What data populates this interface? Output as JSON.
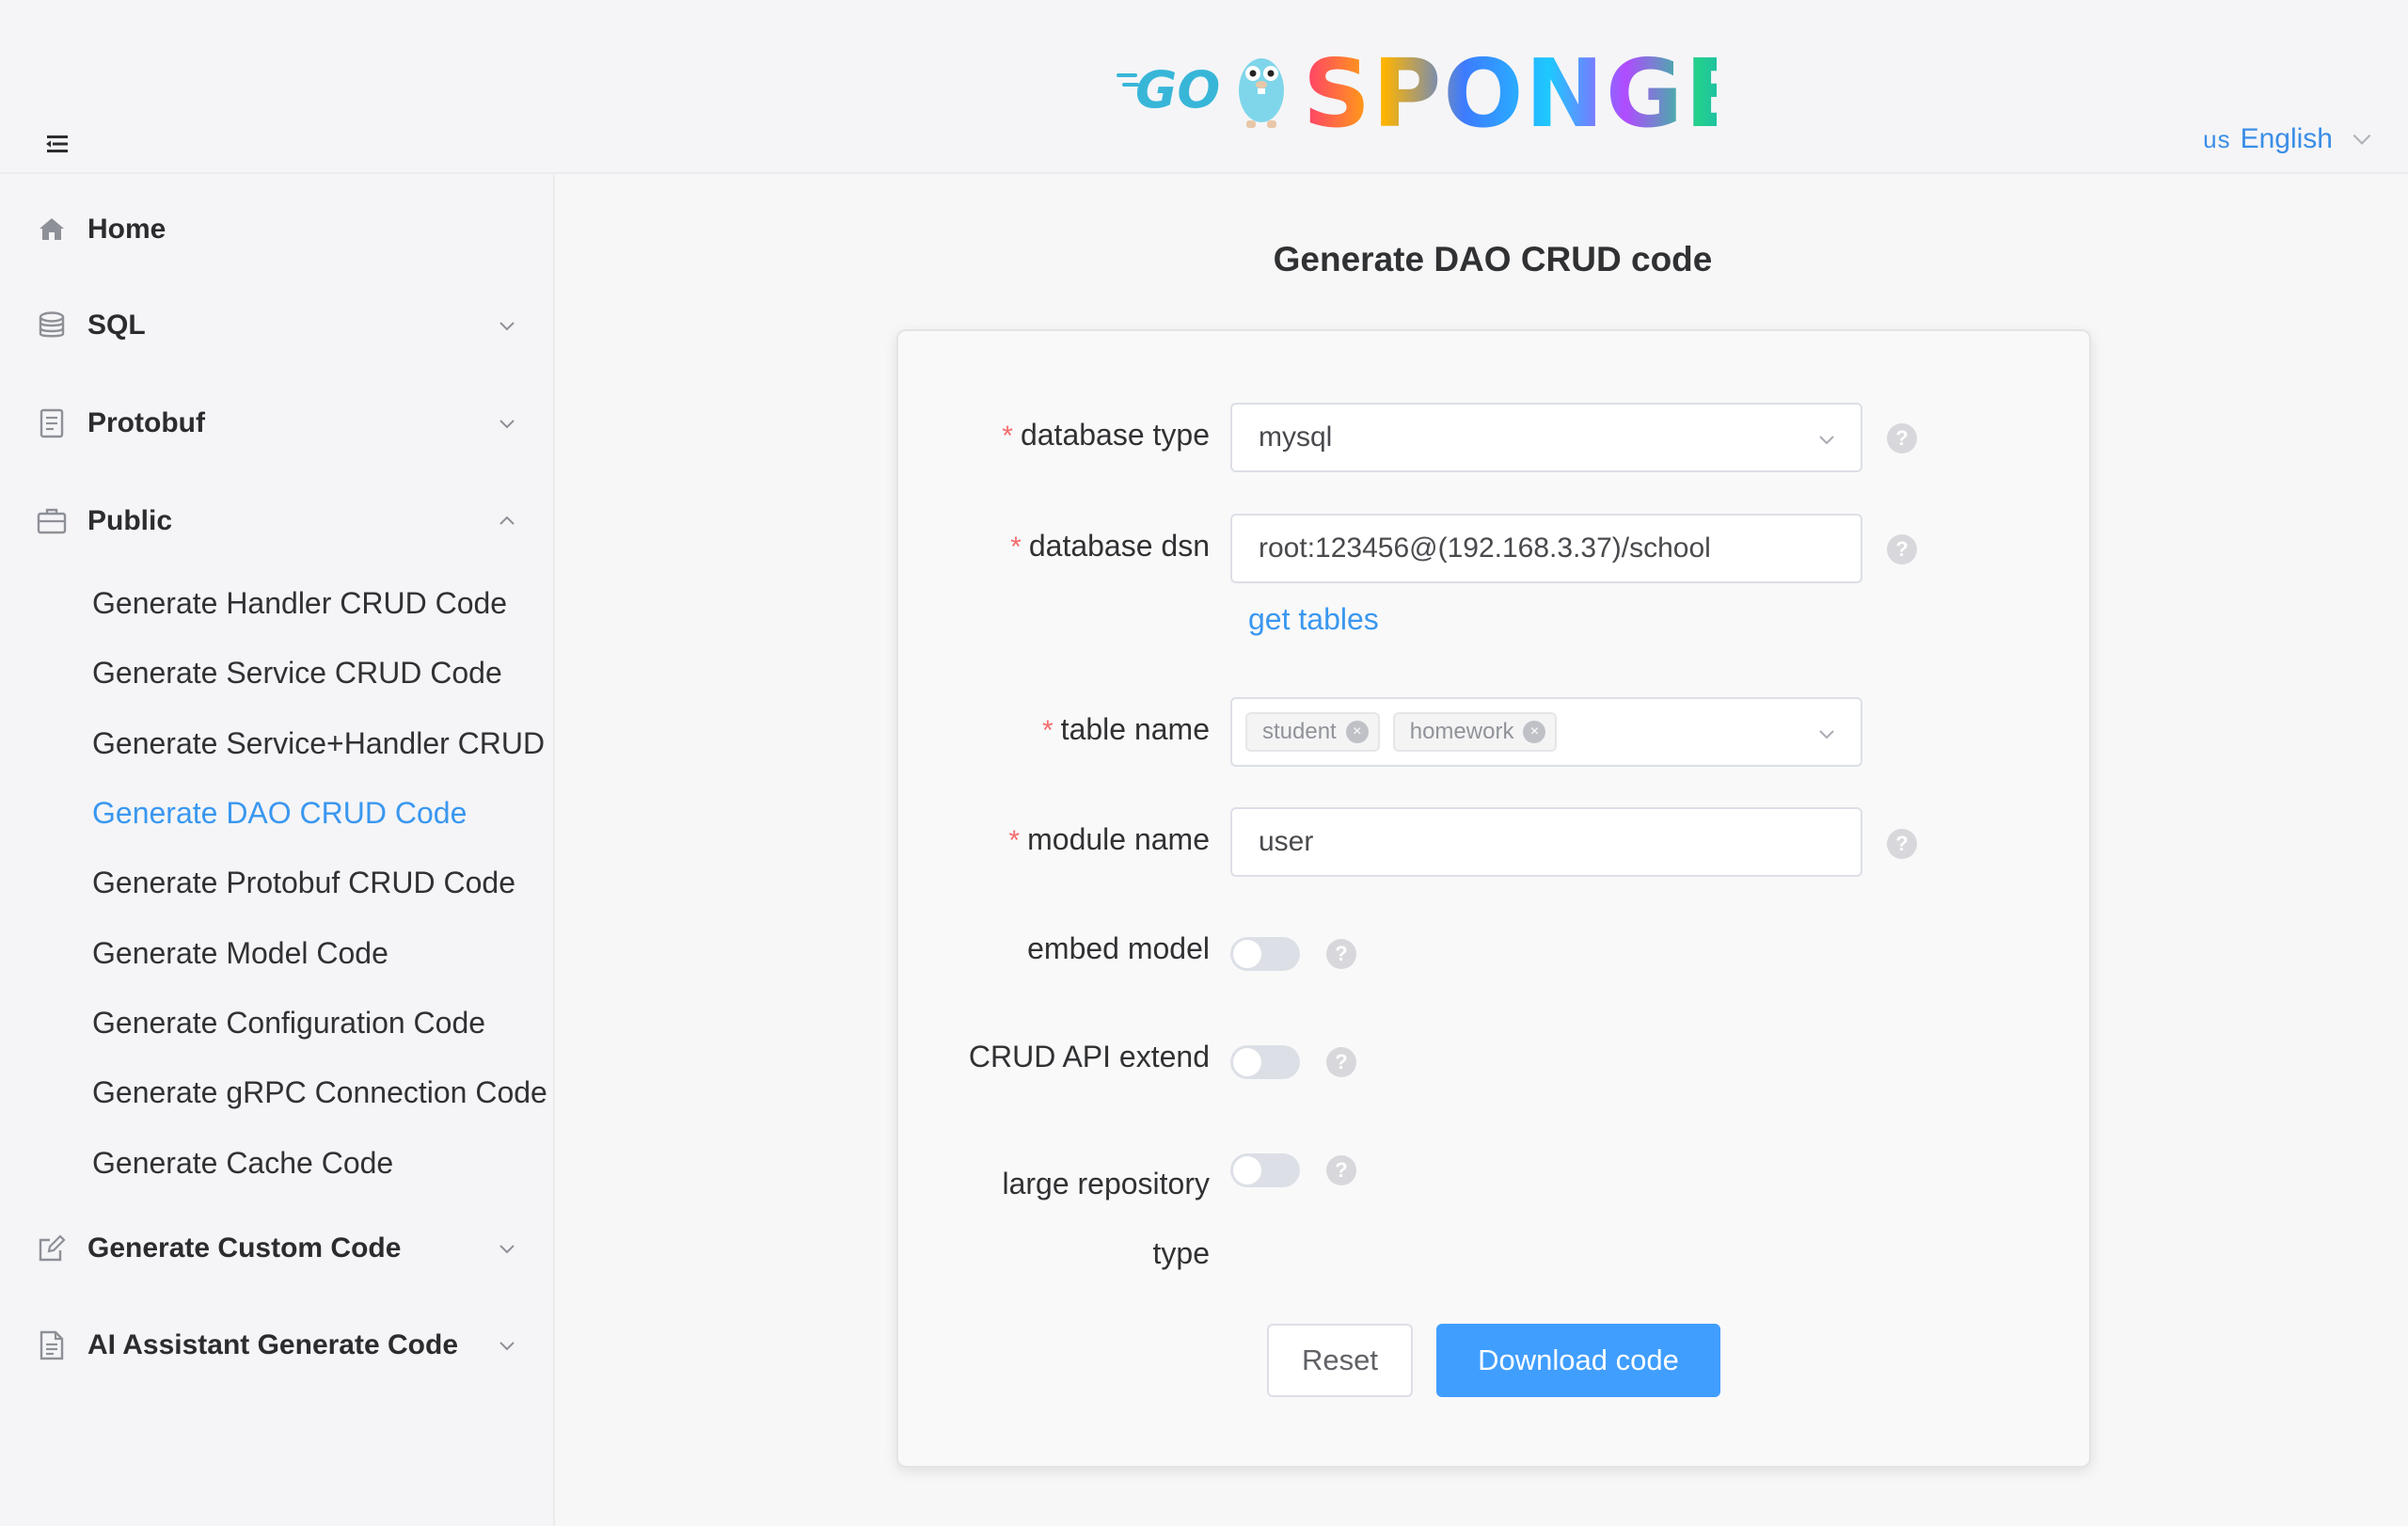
{
  "header": {
    "logo_text": "GO SPONGE",
    "language": {
      "flag": "us",
      "label": "English"
    }
  },
  "sidebar": {
    "groups": [
      {
        "label": "Home",
        "icon": "home-icon"
      },
      {
        "label": "SQL",
        "icon": "database-icon",
        "expanded": false
      },
      {
        "label": "Protobuf",
        "icon": "document-icon",
        "expanded": false
      },
      {
        "label": "Public",
        "icon": "briefcase-icon",
        "expanded": true
      },
      {
        "label": "Generate Custom Code",
        "icon": "edit-icon",
        "expanded": false
      },
      {
        "label": "AI Assistant Generate Code",
        "icon": "file-text-icon",
        "expanded": false
      }
    ],
    "public_items": [
      {
        "label": "Generate Handler CRUD Code"
      },
      {
        "label": "Generate Service CRUD Code"
      },
      {
        "label": "Generate Service+Handler CRUD C"
      },
      {
        "label": "Generate DAO CRUD Code",
        "active": true
      },
      {
        "label": "Generate Protobuf CRUD Code"
      },
      {
        "label": "Generate Model Code"
      },
      {
        "label": "Generate Configuration Code"
      },
      {
        "label": "Generate gRPC Connection Code"
      },
      {
        "label": "Generate Cache Code"
      }
    ]
  },
  "main": {
    "title": "Generate DAO CRUD code",
    "form": {
      "database_type": {
        "label": "database type",
        "value": "mysql",
        "required": true
      },
      "database_dsn": {
        "label": "database dsn",
        "value": "root:123456@(192.168.3.37)/school",
        "required": true
      },
      "get_tables_link": "get tables",
      "table_name": {
        "label": "table name",
        "tags": [
          "student",
          "homework"
        ],
        "required": true
      },
      "module_name": {
        "label": "module name",
        "value": "user",
        "required": true
      },
      "embed_model": {
        "label": "embed model",
        "on": false
      },
      "crud_api_extend": {
        "label": "CRUD API extend",
        "on": false
      },
      "large_repository": {
        "label_line1": "large repository",
        "label_line2": "type",
        "on": false
      },
      "required_mark": "*",
      "help_glyph": "?",
      "tag_close_glyph": "×"
    },
    "buttons": {
      "reset": "Reset",
      "download": "Download code"
    }
  },
  "colors": {
    "accent": "#409eff",
    "link": "#3a97ef",
    "required": "#f56c6c"
  }
}
